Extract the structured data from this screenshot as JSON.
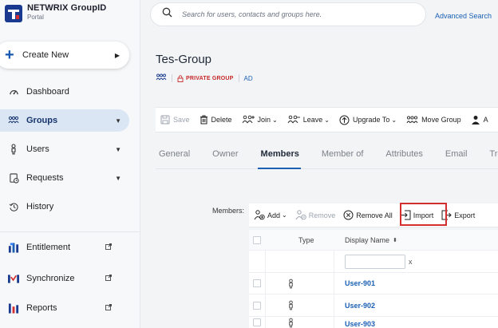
{
  "brand": {
    "title": "NETWRIX GroupID",
    "subtitle": "Portal"
  },
  "sidebar": {
    "create_label": "Create New",
    "items": [
      {
        "label": "Dashboard",
        "icon": "gauge-icon"
      },
      {
        "label": "Groups",
        "icon": "groups-icon",
        "active": true
      },
      {
        "label": "Users",
        "icon": "user-icon"
      },
      {
        "label": "Requests",
        "icon": "requests-icon"
      },
      {
        "label": "History",
        "icon": "history-icon"
      },
      {
        "label": "Entitlement",
        "icon": "entitlement-icon"
      },
      {
        "label": "Synchronize",
        "icon": "synchronize-icon"
      },
      {
        "label": "Reports",
        "icon": "reports-icon"
      }
    ]
  },
  "search": {
    "placeholder": "Search for users, contacts and groups here.",
    "advanced": "Advanced Search"
  },
  "group": {
    "title": "Tes-Group",
    "privacy": "PRIVATE GROUP",
    "source": "AD"
  },
  "toolbar": {
    "save": "Save",
    "delete": "Delete",
    "join": "Join",
    "leave": "Leave",
    "upgrade": "Upgrade To",
    "move": "Move Group",
    "overflow": "A"
  },
  "tabs": [
    "General",
    "Owner",
    "Members",
    "Member of",
    "Attributes",
    "Email",
    "Tree Vie"
  ],
  "active_tab": "Members",
  "members": {
    "label": "Members:",
    "toolbar": {
      "add": "Add",
      "remove": "Remove",
      "remove_all": "Remove All",
      "import": "Import",
      "export": "Export"
    },
    "columns": {
      "type": "Type",
      "display_name": "Display Name"
    },
    "filter_clear": "x",
    "rows": [
      {
        "name": "User-901"
      },
      {
        "name": "User-902"
      },
      {
        "name": "User-903"
      }
    ]
  },
  "colors": {
    "accent": "#1a5fb4",
    "private": "#c62828",
    "highlight": "#d32f2f"
  }
}
